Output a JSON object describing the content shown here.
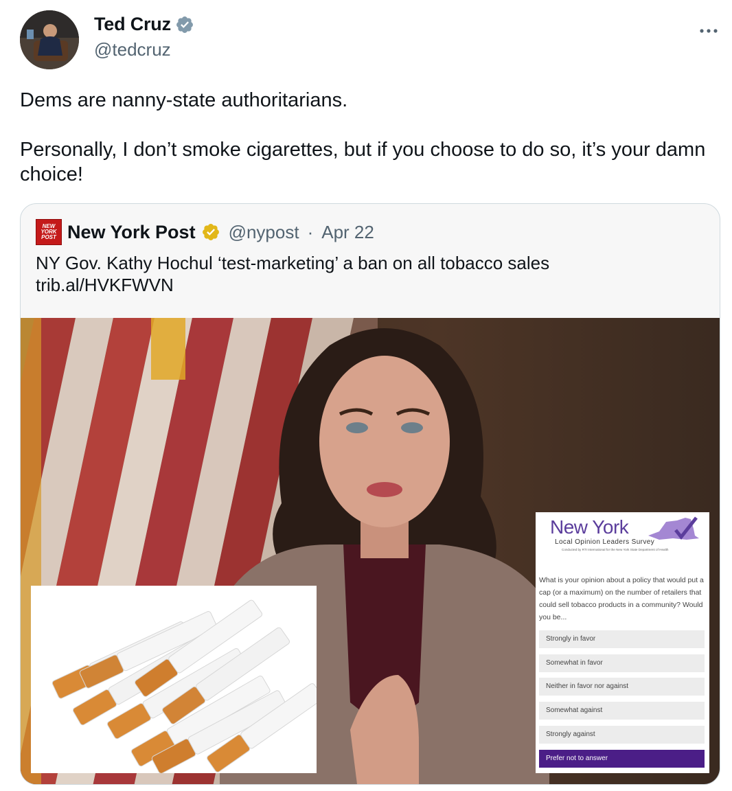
{
  "author": {
    "name": "Ted Cruz",
    "handle": "@tedcruz",
    "verified": true,
    "verified_color": "#829aab"
  },
  "more_icon": "more-horizontal-icon",
  "tweet": {
    "paragraphs": [
      "Dems are nanny-state authoritarians.",
      "Personally, I don’t smoke cigarettes, but if you choose to do so, it’s your damn choice!"
    ]
  },
  "quote": {
    "logo_text": "NEW YORK POST",
    "name": "New York Post",
    "verified_color": "#e2b719",
    "handle": "@nypost",
    "separator": "·",
    "date": "Apr 22",
    "text_line1": "NY Gov. Kathy Hochul ‘test-marketing’ a ban on all tobacco sales",
    "text_line2": "trib.al/HVKFWVN"
  },
  "survey": {
    "title": "New York",
    "subtitle": "Local Opinion Leaders Survey",
    "conducted_by": "Conducted by RTI International for the New York State Department of Health",
    "question": "What is your opinion about a policy that would put a cap (or a maximum) on the number of retailers that could sell tobacco products in a community? Would you be...",
    "options": [
      "Strongly in favor",
      "Somewhat in favor",
      "Neither in favor nor against",
      "Somewhat against",
      "Strongly against",
      "Prefer not to answer"
    ],
    "selected_option": "Prefer not to answer",
    "accent_color": "#4b1e87"
  }
}
